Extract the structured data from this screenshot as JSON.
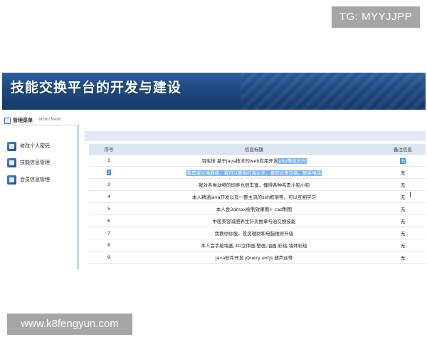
{
  "watermarks": {
    "top_right": "TG: MYYJJPP",
    "bottom_left": "www.k8fengyun.com"
  },
  "banner": {
    "title": "技能交换平台的开发与建设"
  },
  "sidebar": {
    "header_title": "管理菜单",
    "header_sub": "MENU MANU",
    "items": [
      {
        "label": "修改个人密码",
        "icon": "user-key-icon"
      },
      {
        "label": "技能信息管理",
        "icon": "document-icon"
      },
      {
        "label": "会员信息管理",
        "icon": "users-icon"
      }
    ]
  },
  "table": {
    "columns": [
      "序号",
      "信息标题",
      "备注信息"
    ],
    "rows": [
      {
        "no": "1",
        "title_plain": "羽毛球 基于java技术的web应用开发",
        "title_selected": "php等也已行",
        "note": "无"
      },
      {
        "no": "2",
        "title_plain": "",
        "title_selected": "我是金沙滩教练，我可以教你打高尔夫，喜欢过来交换，联系电话",
        "note": "无"
      },
      {
        "no": "3",
        "title_plain": "我对各类动物的饲养也很丰富，懂得各种名贵小狗小狗",
        "title_selected": "",
        "note": "无"
      },
      {
        "no": "4",
        "title_plain": "本人精通java开发以及一整主流的ssh框架等，可以互相学习",
        "title_selected": "",
        "note": "无"
      },
      {
        "no": "5",
        "title_plain": "本人会3dmax绘制效果图+ cad制图",
        "title_selected": "",
        "note": "无"
      },
      {
        "no": "6",
        "title_plain": "中医美容减肥养生针灸推拿与治交换技能",
        "title_selected": "",
        "note": "无"
      },
      {
        "no": "7",
        "title_plain": "我教你炒股，投资理财和电脑维修升级",
        "title_selected": "",
        "note": "无"
      },
      {
        "no": "8",
        "title_plain": "本人会手绘墙画,3D立体画,壁画,油画,彩绘,墙体彩绘",
        "title_selected": "",
        "note": "无"
      },
      {
        "no": "9",
        "title_plain": "java软件开发 jQuery extjs 葫芦丝等",
        "title_selected": "",
        "note": "无"
      }
    ]
  },
  "colors": {
    "banner": "#1e4a82",
    "selection": "#3b8fe8",
    "table_header": "#dde7f2"
  }
}
